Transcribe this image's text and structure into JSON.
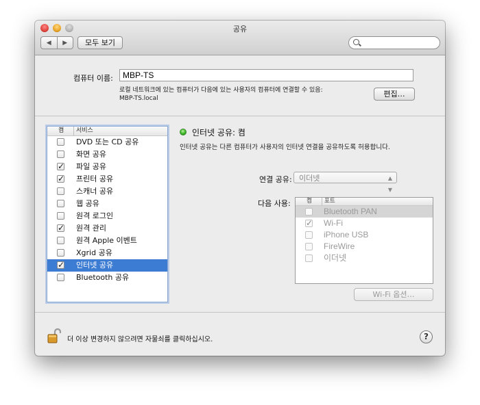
{
  "window": {
    "title": "공유"
  },
  "toolbar": {
    "back_glyph": "◀",
    "forward_glyph": "▶",
    "show_all_label": "모두 보기",
    "search_placeholder": ""
  },
  "computer": {
    "label": "컴퓨터 이름:",
    "name": "MBP-TS",
    "note_line1": "로컬 네트워크에 있는 컴퓨터가 다음에 있는 사용자의 컴퓨터에 연결할 수 있음:",
    "note_line2": "MBP-TS.local",
    "edit_label": "편집…"
  },
  "services": {
    "col_on": "켬",
    "col_service": "서비스",
    "items": [
      {
        "label": "DVD 또는 CD 공유",
        "mark": ""
      },
      {
        "label": "화면 공유",
        "mark": ""
      },
      {
        "label": "파일 공유",
        "mark": "✓"
      },
      {
        "label": "프린터 공유",
        "mark": "✓"
      },
      {
        "label": "스캐너 공유",
        "mark": ""
      },
      {
        "label": "웹 공유",
        "mark": ""
      },
      {
        "label": "원격 로그인",
        "mark": ""
      },
      {
        "label": "원격 관리",
        "mark": "✓"
      },
      {
        "label": "원격 Apple 이벤트",
        "mark": ""
      },
      {
        "label": "Xgrid 공유",
        "mark": ""
      },
      {
        "label": "인터넷 공유",
        "mark": "✓"
      },
      {
        "label": "Bluetooth 공유",
        "mark": ""
      }
    ],
    "selected_index": 10
  },
  "detail": {
    "status": "인터넷 공유: 켬",
    "status_color": "#3ab626",
    "description": "인터넷 공유는 다른 컴퓨터가 사용자의 인터넷 연결을 공유하도록 허용합니다.",
    "share_from_label": "연결 공유:",
    "share_from_value": "이더넷",
    "to_label": "다음 사용:",
    "ports": {
      "col_on": "켬",
      "col_port": "포트",
      "items": [
        {
          "label": "Bluetooth PAN",
          "mark": ""
        },
        {
          "label": "Wi-Fi",
          "mark": "✓"
        },
        {
          "label": "iPhone USB",
          "mark": ""
        },
        {
          "label": "FireWire",
          "mark": ""
        },
        {
          "label": "이더넷",
          "mark": ""
        }
      ],
      "selected_index": 0
    },
    "wifi_options_label": "Wi-Fi 옵션…"
  },
  "footer": {
    "lock_text": "더 이상 변경하지 않으려면 자물쇠를 클릭하십시오.",
    "help_label": "?"
  }
}
